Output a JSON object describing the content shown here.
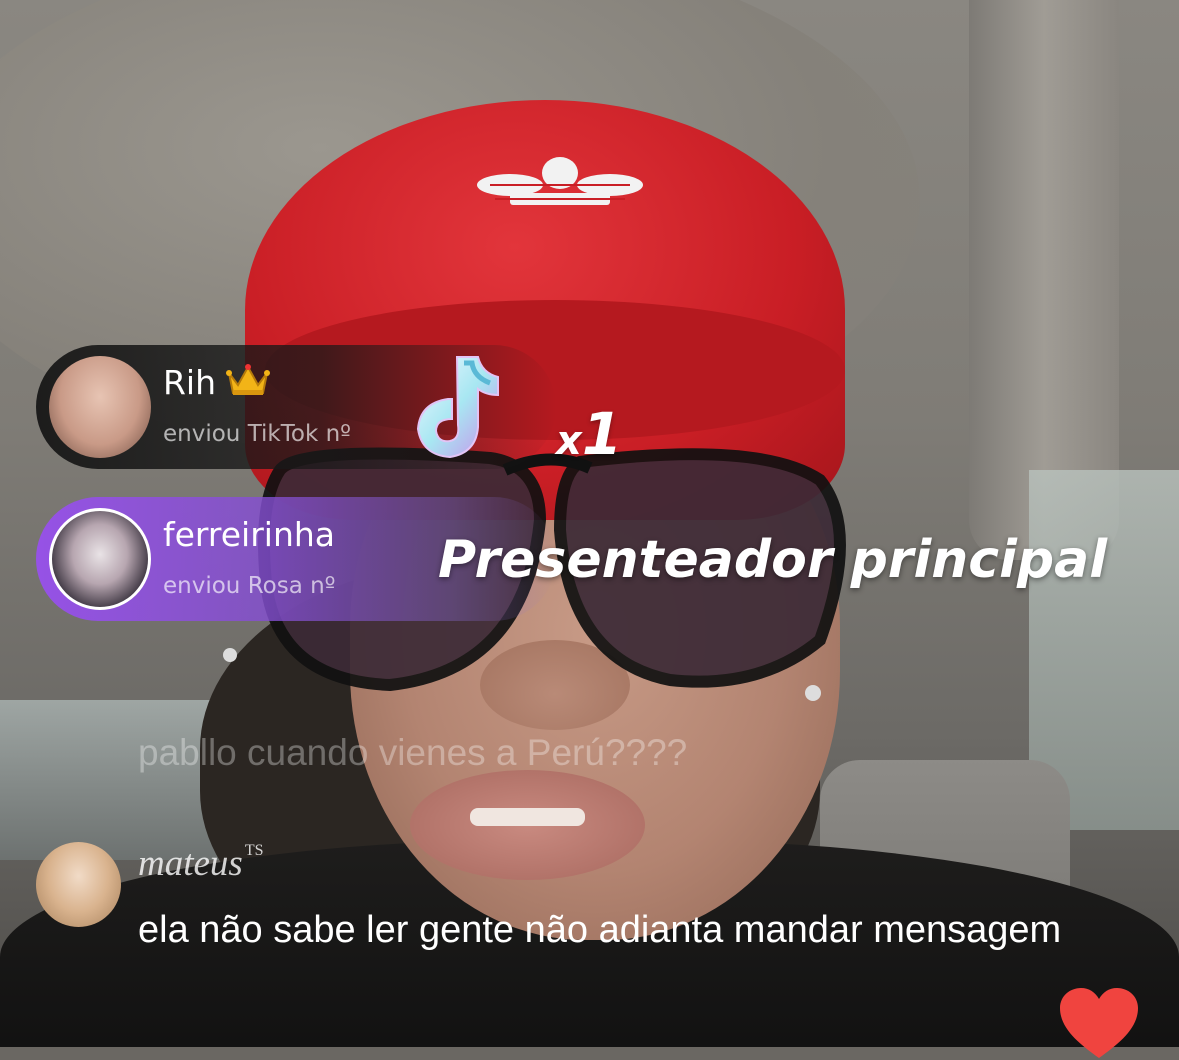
{
  "gifts": [
    {
      "user": "Rih",
      "badge": "crown-icon",
      "action": "enviou TikTok nº"
    },
    {
      "user": "ferreirinha",
      "action": "enviou Rosa nº"
    }
  ],
  "gift_count": {
    "prefix": "x",
    "value": "1"
  },
  "top_gifter_label": "Presenteador principal",
  "faded_comment": "pabllo cuando vienes a Perú????",
  "comment": {
    "user": "mateus",
    "user_suffix": "TS",
    "text": "ela não sabe ler gente não adianta mandar mensagem"
  },
  "colors": {
    "purple_banner": "#9652e6",
    "heart": "#f0443f",
    "cap_red": "#c91e25"
  }
}
